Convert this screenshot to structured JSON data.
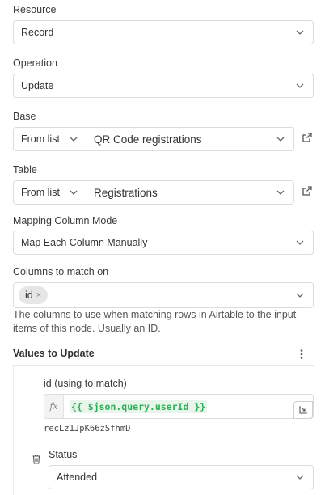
{
  "resource": {
    "label": "Resource",
    "value": "Record"
  },
  "operation": {
    "label": "Operation",
    "value": "Update"
  },
  "base": {
    "label": "Base",
    "mode": "From list",
    "value": "QR Code registrations"
  },
  "table": {
    "label": "Table",
    "mode": "From list",
    "value": "Registrations"
  },
  "mapping": {
    "label": "Mapping Column Mode",
    "value": "Map Each Column Manually"
  },
  "columns_match": {
    "label": "Columns to match on",
    "chip": "id",
    "chip_remove": "×",
    "hint": "The columns to use when matching rows in Airtable to the input items of this node. Usually an ID."
  },
  "values_section": {
    "title": "Values to Update",
    "id_field": {
      "label": "id (using to match)",
      "fx": "fx",
      "expression": "{{ $json.query.userId }}",
      "result": "recLz1JpK66zSfhmD"
    },
    "status_field": {
      "label": "Status",
      "value": "Attended"
    }
  },
  "icons": {
    "dropdown": "chevron-down-icon",
    "external": "external-link-icon",
    "options": "vertical-dots-icon",
    "expand": "expand-icon",
    "delete": "trash-icon"
  },
  "colors": {
    "expression_text": "#2eae59",
    "expression_bg": "#e7f5ea",
    "border": "#dcdcdc"
  }
}
